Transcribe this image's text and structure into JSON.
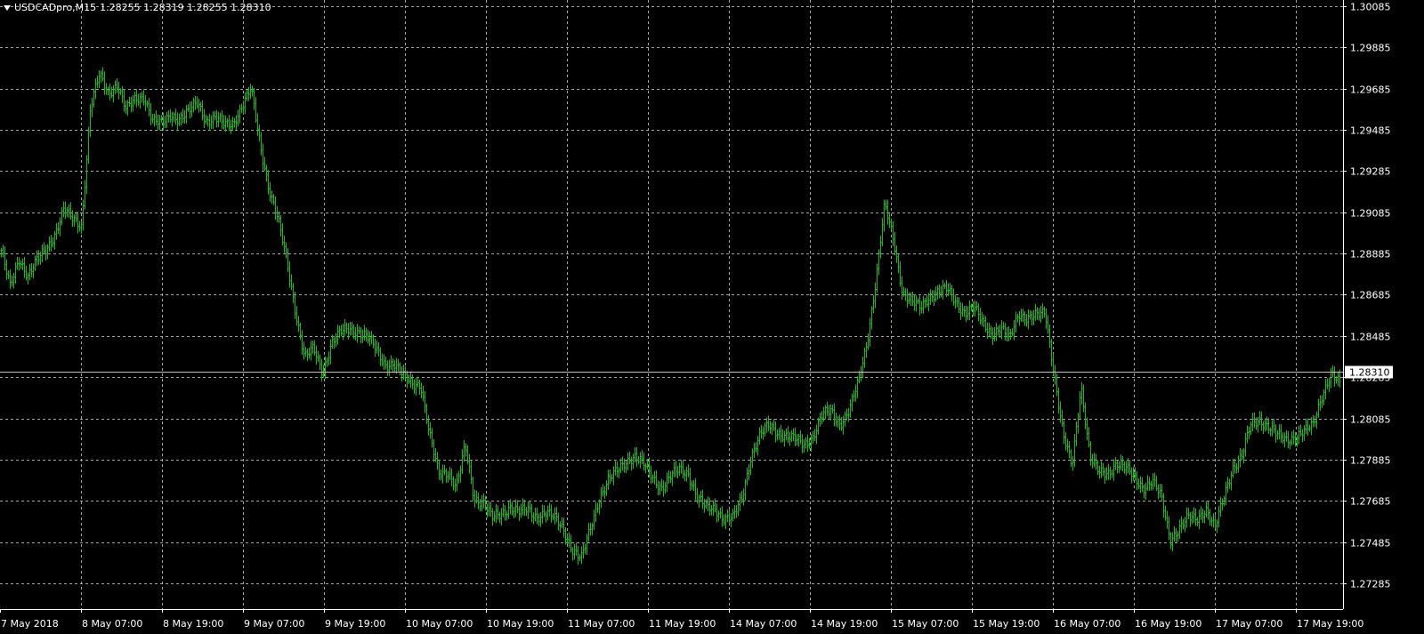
{
  "window": {
    "symbol": "USDCADpro,M15",
    "ohlc": "1.28255 1.28319 1.28255 1.28310"
  },
  "colors": {
    "background": "#000000",
    "bars": "#00c800",
    "grid": "#c0c0c0",
    "axis_text": "#ffffff",
    "bid_line": "#c0c0c0"
  },
  "chart_data": {
    "type": "line",
    "style": "price bars",
    "grid": true,
    "ylim": [
      1.2716,
      1.30115
    ],
    "y_ticks": [
      "1.30085",
      "1.29885",
      "1.29685",
      "1.29485",
      "1.29285",
      "1.29085",
      "1.28885",
      "1.28685",
      "1.28485",
      "1.28285",
      "1.28085",
      "1.27885",
      "1.27685",
      "1.27485",
      "1.27285"
    ],
    "x_ticks": [
      "7 May 2018",
      "8 May 07:00",
      "8 May 19:00",
      "9 May 07:00",
      "9 May 19:00",
      "10 May 07:00",
      "10 May 19:00",
      "11 May 07:00",
      "11 May 19:00",
      "14 May 07:00",
      "14 May 19:00",
      "15 May 07:00",
      "15 May 19:00",
      "16 May 07:00",
      "16 May 19:00",
      "17 May 07:00",
      "17 May 19:00"
    ],
    "current_price": "1.28310",
    "series": [
      {
        "values": [
          1.289,
          1.2872,
          1.2886,
          1.2878,
          1.2885,
          1.289,
          1.2898,
          1.291,
          1.2905,
          1.2902,
          1.296,
          1.2975,
          1.2966,
          1.2971,
          1.2958,
          1.2963,
          1.2965,
          1.2953,
          1.2951,
          1.2956,
          1.2954,
          1.2957,
          1.2962,
          1.2953,
          1.2954,
          1.2951,
          1.2952,
          1.296,
          1.2968,
          1.2942,
          1.292,
          1.2905,
          1.2885,
          1.286,
          1.2838,
          1.2842,
          1.2831,
          1.2845,
          1.285,
          1.2852,
          1.2851,
          1.2848,
          1.2842,
          1.2835,
          1.2835,
          1.2829,
          1.2826,
          1.2825,
          1.28,
          1.2782,
          1.2783,
          1.2775,
          1.2795,
          1.277,
          1.2768,
          1.276,
          1.2762,
          1.2766,
          1.2763,
          1.2764,
          1.2761,
          1.2763,
          1.276,
          1.2755,
          1.2745,
          1.274,
          1.2755,
          1.277,
          1.2778,
          1.2783,
          1.2788,
          1.279,
          1.2786,
          1.278,
          1.2775,
          1.278,
          1.2784,
          1.2782,
          1.277,
          1.2765,
          1.2765,
          1.276,
          1.276,
          1.277,
          1.279,
          1.28,
          1.2805,
          1.2802,
          1.28,
          1.2798,
          1.2796,
          1.28,
          1.281,
          1.2812,
          1.2806,
          1.2812,
          1.2825,
          1.2845,
          1.2875,
          1.2912,
          1.2895,
          1.287,
          1.2865,
          1.2862,
          1.2868,
          1.287,
          1.2871,
          1.2865,
          1.286,
          1.2862,
          1.2855,
          1.285,
          1.2852,
          1.2847,
          1.286,
          1.2857,
          1.2858,
          1.286,
          1.283,
          1.28,
          1.2785,
          1.2825,
          1.279,
          1.2782,
          1.2782,
          1.2787,
          1.2784,
          1.278,
          1.2775,
          1.2778,
          1.277,
          1.275,
          1.2755,
          1.276,
          1.276,
          1.2765,
          1.2755,
          1.277,
          1.2785,
          1.279,
          1.2805,
          1.2808,
          1.2805,
          1.28,
          1.2798,
          1.28,
          1.2802,
          1.2805,
          1.282,
          1.283,
          1.2825
        ]
      }
    ]
  }
}
